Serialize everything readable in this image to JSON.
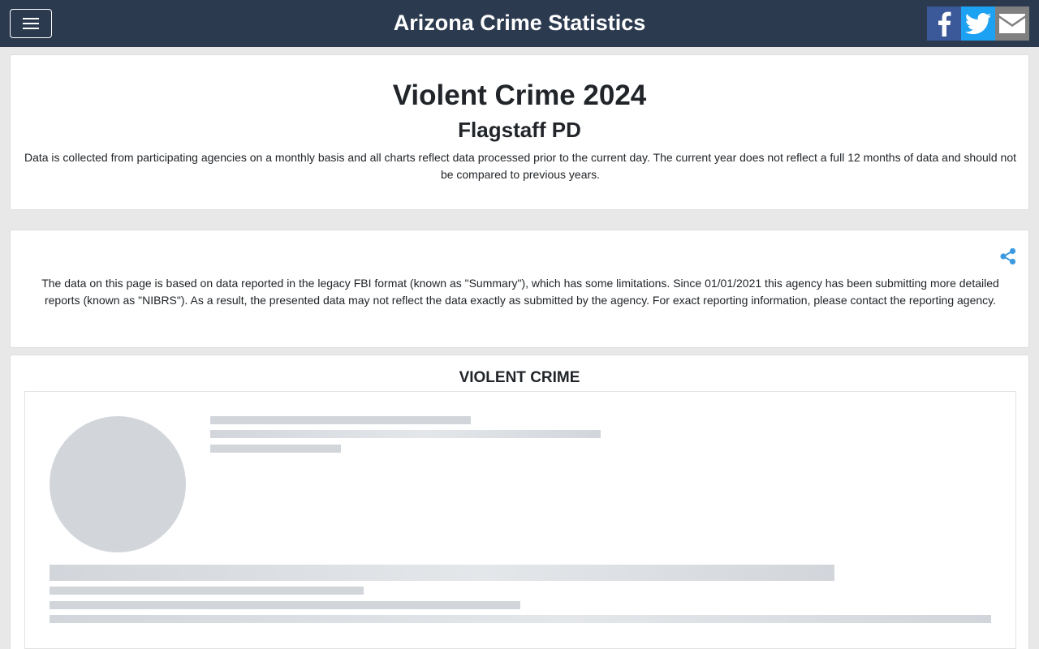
{
  "header": {
    "title": "Arizona Crime Statistics",
    "menu_icon": "hamburger-menu-icon",
    "social": [
      {
        "name": "facebook",
        "icon": "facebook-icon",
        "color": "#3b5998"
      },
      {
        "name": "twitter",
        "icon": "twitter-icon",
        "color": "#1da1f2"
      },
      {
        "name": "email",
        "icon": "envelope-icon",
        "color": "#808080"
      }
    ]
  },
  "intro": {
    "title": "Violent Crime 2024",
    "agency": "Flagstaff PD",
    "disclaimer": "Data is collected from participating agencies on a monthly basis and all charts reflect data processed prior to the current day. The current year does not reflect a full 12 months of data and should not be compared to previous years."
  },
  "notice": {
    "share_icon": "share-icon",
    "text": "The data on this page is based on data reported in the legacy FBI format (known as \"Summary\"), which has some limitations. Since 01/01/2021 this agency has been submitting more detailed reports (known as \"NIBRS\"). As a result, the presented data may not reflect the data exactly as submitted by the agency. For exact reporting information, please contact the reporting agency."
  },
  "section": {
    "title": "VIOLENT CRIME",
    "state": "loading"
  },
  "colors": {
    "navbar": "#2b3a4f",
    "share_accent": "#3b9ae1",
    "skeleton": "#d2d6db"
  }
}
